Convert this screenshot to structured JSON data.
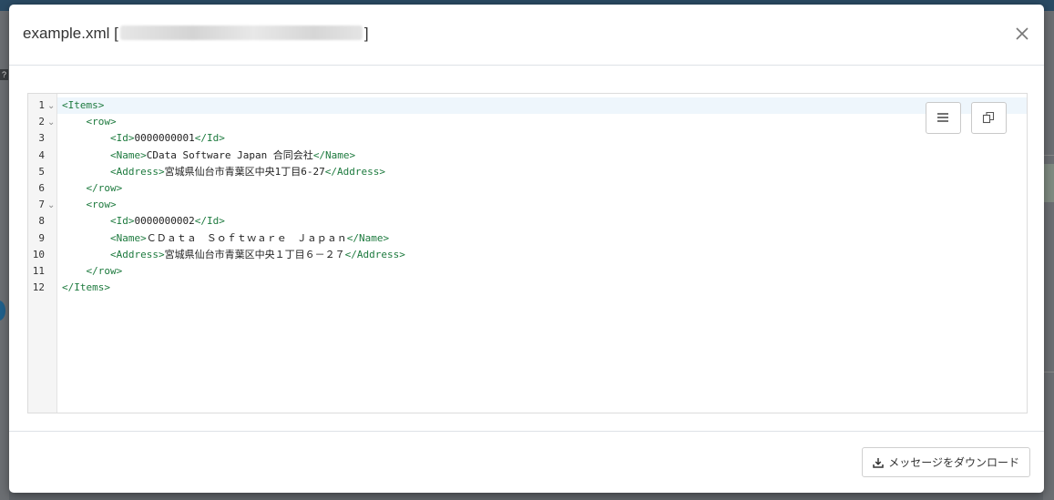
{
  "dialog": {
    "title_prefix": "example.xml [",
    "title_suffix": "]",
    "close_icon": "close-icon"
  },
  "editor": {
    "toolbar": [
      {
        "icon": "format-lines-icon"
      },
      {
        "icon": "copy-icon"
      }
    ],
    "lines": [
      {
        "num": "1",
        "fold": "⌄",
        "parts": [
          {
            "t": "tag",
            "v": "<Items>"
          }
        ]
      },
      {
        "num": "2",
        "fold": "⌄",
        "parts": [
          {
            "t": "txt",
            "v": "    "
          },
          {
            "t": "tag",
            "v": "<row>"
          }
        ]
      },
      {
        "num": "3",
        "fold": "",
        "parts": [
          {
            "t": "txt",
            "v": "        "
          },
          {
            "t": "tag",
            "v": "<Id>"
          },
          {
            "t": "txt",
            "v": "0000000001"
          },
          {
            "t": "tag",
            "v": "</Id>"
          }
        ]
      },
      {
        "num": "4",
        "fold": "",
        "parts": [
          {
            "t": "txt",
            "v": "        "
          },
          {
            "t": "tag",
            "v": "<Name>"
          },
          {
            "t": "txt",
            "v": "CData Software Japan 合同会社"
          },
          {
            "t": "tag",
            "v": "</Name>"
          }
        ]
      },
      {
        "num": "5",
        "fold": "",
        "parts": [
          {
            "t": "txt",
            "v": "        "
          },
          {
            "t": "tag",
            "v": "<Address>"
          },
          {
            "t": "txt",
            "v": "宮城県仙台市青葉区中央1丁目6-27"
          },
          {
            "t": "tag",
            "v": "</Address>"
          }
        ]
      },
      {
        "num": "6",
        "fold": "",
        "parts": [
          {
            "t": "txt",
            "v": "    "
          },
          {
            "t": "tag",
            "v": "</row>"
          }
        ]
      },
      {
        "num": "7",
        "fold": "⌄",
        "parts": [
          {
            "t": "txt",
            "v": "    "
          },
          {
            "t": "tag",
            "v": "<row>"
          }
        ]
      },
      {
        "num": "8",
        "fold": "",
        "parts": [
          {
            "t": "txt",
            "v": "        "
          },
          {
            "t": "tag",
            "v": "<Id>"
          },
          {
            "t": "txt",
            "v": "0000000002"
          },
          {
            "t": "tag",
            "v": "</Id>"
          }
        ]
      },
      {
        "num": "9",
        "fold": "",
        "parts": [
          {
            "t": "txt",
            "v": "        "
          },
          {
            "t": "tag",
            "v": "<Name>"
          },
          {
            "t": "txt",
            "v": "ＣＤａｔａ　Ｓｏｆｔｗａｒｅ　Ｊａｐａｎ"
          },
          {
            "t": "tag",
            "v": "</Name>"
          }
        ]
      },
      {
        "num": "10",
        "fold": "",
        "parts": [
          {
            "t": "txt",
            "v": "        "
          },
          {
            "t": "tag",
            "v": "<Address>"
          },
          {
            "t": "txt",
            "v": "宮城県仙台市青葉区中央１丁目６－２７"
          },
          {
            "t": "tag",
            "v": "</Address>"
          }
        ]
      },
      {
        "num": "11",
        "fold": "",
        "parts": [
          {
            "t": "txt",
            "v": "    "
          },
          {
            "t": "tag",
            "v": "</row>"
          }
        ]
      },
      {
        "num": "12",
        "fold": "",
        "parts": [
          {
            "t": "tag",
            "v": "</Items>"
          }
        ]
      }
    ]
  },
  "footer": {
    "download_icon": "download-icon",
    "download_label": "メッセージをダウンロード"
  }
}
